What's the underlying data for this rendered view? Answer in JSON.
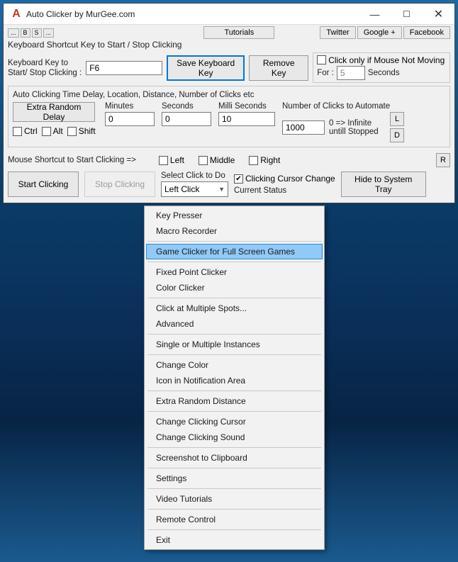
{
  "titlebar": {
    "icon_letter": "A",
    "title": "Auto Clicker by MurGee.com"
  },
  "toprow": {
    "tiny1": "...",
    "tiny2": "B",
    "tiny3": "S",
    "tiny4": "...",
    "tutorials": "Tutorials",
    "twitter": "Twitter",
    "googleplus": "Google +",
    "facebook": "Facebook",
    "shortcut_label": "Keyboard Shortcut Key to Start / Stop Clicking"
  },
  "shortcut": {
    "label1": "Keyboard Key to",
    "label2": "Start/ Stop Clicking :",
    "value": "F6",
    "save": "Save Keyboard Key",
    "remove": "Remove Key",
    "clickonly_label": "Click only if Mouse Not Moving",
    "for": "For :",
    "for_value": "5",
    "seconds": "Seconds"
  },
  "timing": {
    "header": "Auto Clicking Time Delay, Location, Distance, Number of Clicks etc",
    "extra_random": "Extra Random Delay",
    "ctrl": "Ctrl",
    "alt": "Alt",
    "shift": "Shift",
    "minutes_label": "Minutes",
    "minutes_value": "0",
    "seconds_label": "Seconds",
    "seconds_value": "0",
    "ms_label": "Milli Seconds",
    "ms_value": "10",
    "clicks_label": "Number of Clicks to Automate",
    "clicks_value": "1000",
    "infinite": "0 => Infinite untill Stopped",
    "L": "L",
    "D": "D"
  },
  "mouse_shortcut": {
    "label": "Mouse Shortcut to Start Clicking =>",
    "left": "Left",
    "middle": "Middle",
    "right": "Right",
    "R": "R"
  },
  "bottom": {
    "start": "Start Clicking",
    "stop": "Stop Clicking",
    "select_label": "Select Click to Do",
    "select_value": "Left Click",
    "cursor_change": "Clicking Cursor Change",
    "status": "Current Status",
    "hide": "Hide to System Tray"
  },
  "menu": {
    "items": [
      {
        "label": "Key Presser",
        "sep": false
      },
      {
        "label": "Macro Recorder",
        "sep": true
      },
      {
        "label": "Game Clicker for Full Screen Games",
        "sep": true,
        "highlight": true
      },
      {
        "label": "Fixed Point Clicker",
        "sep": false
      },
      {
        "label": "Color Clicker",
        "sep": true
      },
      {
        "label": "Click at Multiple Spots...",
        "sep": false
      },
      {
        "label": "Advanced",
        "sep": true
      },
      {
        "label": "Single or Multiple Instances",
        "sep": true
      },
      {
        "label": "Change Color",
        "sep": false
      },
      {
        "label": "Icon in Notification Area",
        "sep": true
      },
      {
        "label": "Extra Random Distance",
        "sep": true
      },
      {
        "label": "Change Clicking Cursor",
        "sep": false
      },
      {
        "label": "Change Clicking Sound",
        "sep": true
      },
      {
        "label": "Screenshot to Clipboard",
        "sep": true
      },
      {
        "label": "Settings",
        "sep": true
      },
      {
        "label": "Video Tutorials",
        "sep": true
      },
      {
        "label": "Remote Control",
        "sep": true
      },
      {
        "label": "Exit",
        "sep": false
      }
    ]
  }
}
